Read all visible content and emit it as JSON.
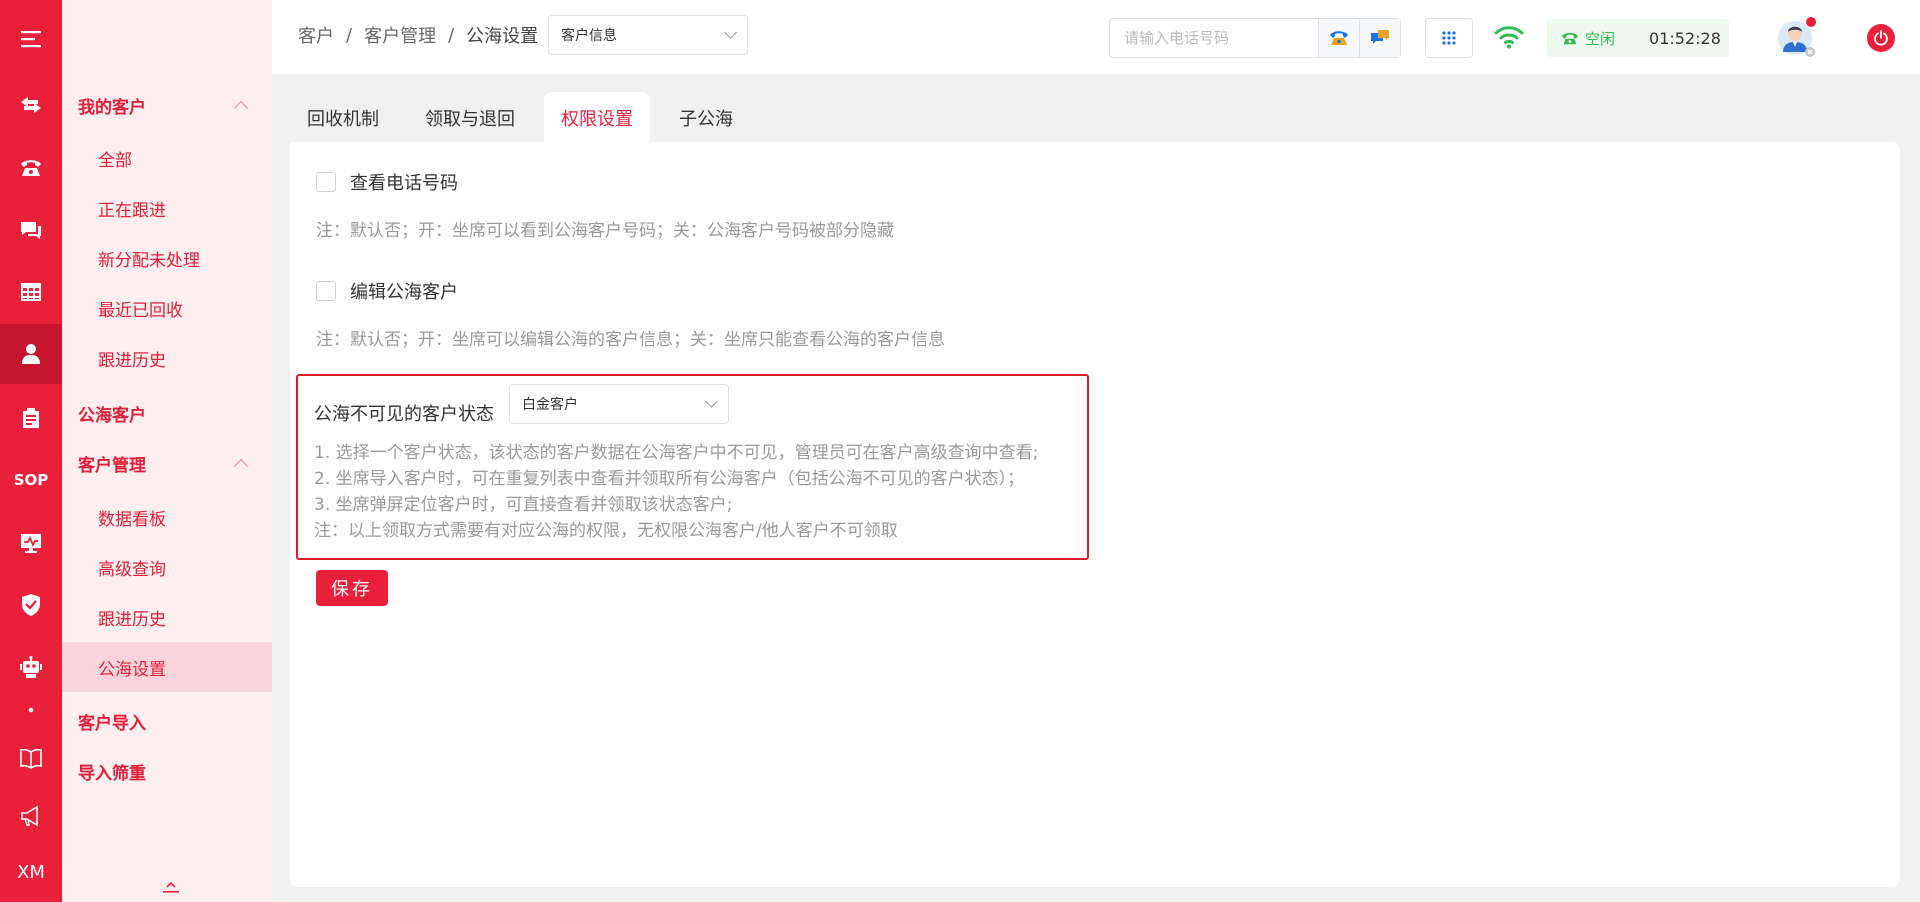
{
  "rail": {
    "items": [
      {
        "icon": "menu-icon"
      },
      {
        "icon": "transfer-icon"
      },
      {
        "icon": "phone-icon"
      },
      {
        "icon": "chat-icon"
      },
      {
        "icon": "table-icon"
      },
      {
        "icon": "customer-icon",
        "active": true
      },
      {
        "icon": "clipboard-icon"
      },
      {
        "icon": "sop-icon",
        "text": "SOP"
      },
      {
        "icon": "monitor-icon"
      },
      {
        "icon": "shield-icon"
      },
      {
        "icon": "robot-icon"
      },
      {
        "icon": "book-icon"
      },
      {
        "icon": "megaphone-icon"
      },
      {
        "icon": "xm-icon",
        "text": "XM"
      }
    ]
  },
  "sidebar": {
    "group_my_customers": "我的客户",
    "my_items": [
      "全部",
      "正在跟进",
      "新分配未处理",
      "最近已回收",
      "跟进历史"
    ],
    "group_public_sea": "公海客户",
    "group_customer_mgmt": "客户管理",
    "mgmt_items": [
      "数据看板",
      "高级查询",
      "跟进历史",
      "公海设置"
    ],
    "group_import": "客户导入",
    "group_dedupe": "导入筛重"
  },
  "header": {
    "crumbs": [
      "客户",
      "客户管理",
      "公海设置"
    ],
    "crumb_sep": "/",
    "module_select": "客户信息",
    "phone_placeholder": "请输入电话号码",
    "status_label": "空闲",
    "time": "01:52:28",
    "colors": {
      "brand": "#e8203a",
      "status_green": "#2fbd4f"
    }
  },
  "tabs": [
    "回收机制",
    "领取与退回",
    "权限设置",
    "子公海"
  ],
  "active_tab_index": 2,
  "settings": {
    "view_phone_label": "查看电话号码",
    "view_phone_note": "注：默认否；开：坐席可以看到公海客户号码；关：公海客户号码被部分隐藏",
    "edit_customer_label": "编辑公海客户",
    "edit_customer_note": "注：默认否；开：坐席可以编辑公海的客户信息；关：坐席只能查看公海的客户信息",
    "invisible_status_label": "公海不可见的客户状态",
    "invisible_status_value": "白金客户",
    "tips": [
      "1. 选择一个客户状态，该状态的客户数据在公海客户中不可见，管理员可在客户高级查询中查看;",
      "2. 坐席导入客户时，可在重复列表中查看并领取所有公海客户（包括公海不可见的客户状态）；",
      "3. 坐席弹屏定位客户时，可直接查看并领取该状态客户;",
      "注：以上领取方式需要有对应公海的权限，无权限公海客户/他人客户不可领取"
    ],
    "save_label": "保存"
  }
}
